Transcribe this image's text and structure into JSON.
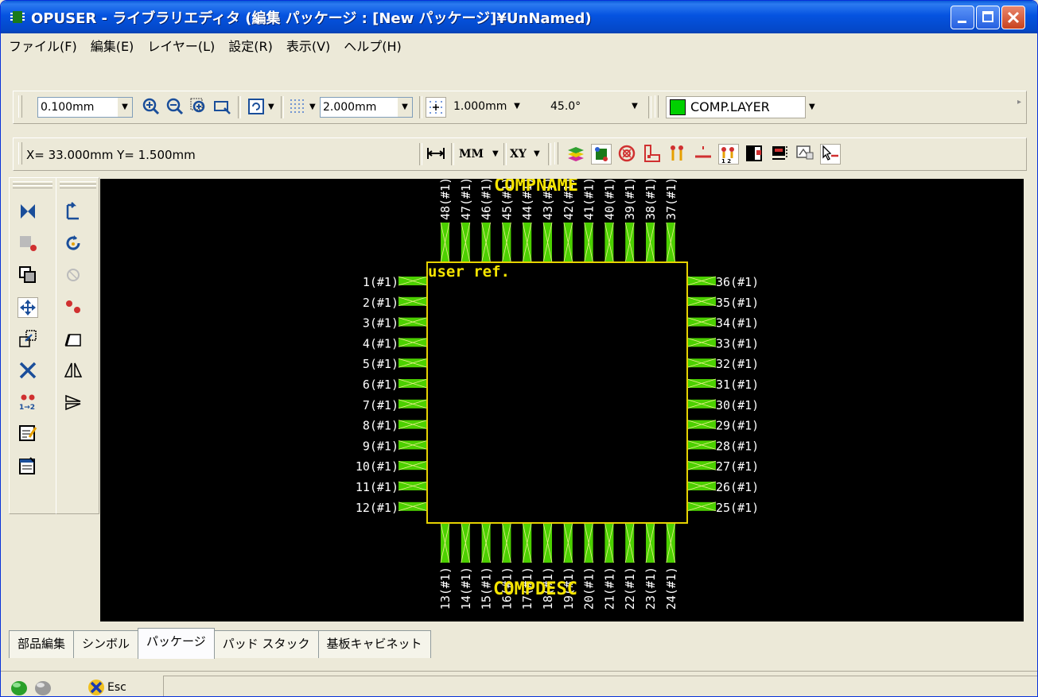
{
  "window": {
    "title": "OPUSER - ライブラリエディタ (編集 パッケージ : [New パッケージ]¥UnNamed)",
    "minimize_label": "_",
    "restore_label": "□",
    "close_label": "✕"
  },
  "menu": [
    "ファイル(F)",
    "編集(E)",
    "レイヤー(L)",
    "設定(R)",
    "表示(V)",
    "ヘルプ(H)"
  ],
  "toolbar1": {
    "snap_value": "0.100mm",
    "grid_value": "2.000mm",
    "grid2_value": "1.000mm",
    "angle_value": "45.0°",
    "layer_value": "COMP.LAYER",
    "layer_color": "#00d000"
  },
  "toolbar2": {
    "coords": "X= 33.000mm   Y= 1.500mm",
    "unit_value": "MM",
    "axis_value": "XY"
  },
  "canvas": {
    "top_label": "COMPNAME",
    "bottom_label": "COMPDESC",
    "ref_label": "user ref.",
    "pins_left": [
      "1(#1)",
      "2(#1)",
      "3(#1)",
      "4(#1)",
      "5(#1)",
      "6(#1)",
      "7(#1)",
      "8(#1)",
      "9(#1)",
      "10(#1)",
      "11(#1)",
      "12(#1)"
    ],
    "pins_right": [
      "36(#1)",
      "35(#1)",
      "34(#1)",
      "33(#1)",
      "32(#1)",
      "31(#1)",
      "30(#1)",
      "29(#1)",
      "28(#1)",
      "27(#1)",
      "26(#1)",
      "25(#1)"
    ],
    "pins_top": [
      "48(#1)",
      "47(#1)",
      "46(#1)",
      "45(#1)",
      "44(#1)",
      "43(#1)",
      "42(#1)",
      "41(#1)",
      "40(#1)",
      "39(#1)",
      "38(#1)",
      "37(#1)"
    ],
    "pins_bottom": [
      "13(#1)",
      "14(#1)",
      "15(#1)",
      "16(#1)",
      "17(#1)",
      "18(#1)",
      "19(#1)",
      "20(#1)",
      "21(#1)",
      "22(#1)",
      "23(#1)",
      "24(#1)"
    ],
    "pad_color": "#4cd000",
    "outline_color": "#e6d200",
    "label_color": "#f5e400"
  },
  "tabs": [
    "部品編集",
    "シンボル",
    "パッケージ",
    "パッド スタック",
    "基板キャビネット"
  ],
  "active_tab": "パッケージ",
  "status": {
    "esc_label": "Esc"
  }
}
